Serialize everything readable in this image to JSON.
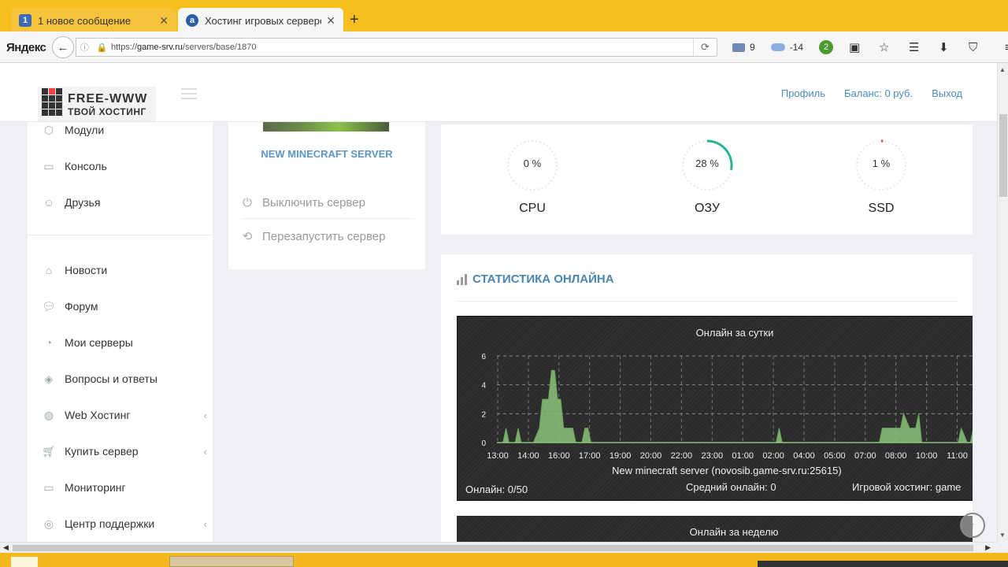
{
  "browser": {
    "tabs": [
      {
        "label": "1 новое сообщение",
        "favicon": "1"
      },
      {
        "label": "Хостинг игровых серверо...",
        "favicon": "a"
      }
    ],
    "new_tab_symbol": "+",
    "brand": "Яндекс",
    "url_prefix": "https://",
    "url_host": "game-srv.ru",
    "url_path": "/servers/base/1870",
    "mail_count": "9",
    "weather": "-14",
    "notif_count": "2"
  },
  "header": {
    "logo_line1": "FREE-WWW",
    "logo_line2": "ТВОЙ ХОСТИНГ",
    "nav": [
      "Профиль",
      "Баланс: 0 руб.",
      "Выход"
    ]
  },
  "sidebar": {
    "items_top": [
      {
        "label": "Модули",
        "icon": "modules-icon"
      },
      {
        "label": "Консоль",
        "icon": "monitor-icon"
      },
      {
        "label": "Друзья",
        "icon": "friends-icon"
      }
    ],
    "items_main": [
      {
        "label": "Новости",
        "icon": "home-icon",
        "arrow": false
      },
      {
        "label": "Форум",
        "icon": "chat-icon",
        "arrow": false
      },
      {
        "label": "Мои серверы",
        "icon": "servers-icon",
        "arrow": false
      },
      {
        "label": "Вопросы и ответы",
        "icon": "layers-icon",
        "arrow": false
      },
      {
        "label": "Web Хостинг",
        "icon": "globe-icon",
        "arrow": true
      },
      {
        "label": "Купить сервер",
        "icon": "cart-icon",
        "arrow": true
      },
      {
        "label": "Мониторинг",
        "icon": "monitor-icon",
        "arrow": false
      },
      {
        "label": "Центр поддержки",
        "icon": "lifebuoy-icon",
        "arrow": true
      }
    ]
  },
  "server": {
    "name": "NEW MINECRAFT SERVER",
    "actions": [
      "Выключить сервер",
      "Перезапустить сервер"
    ]
  },
  "resources": [
    {
      "label": "CPU",
      "value_text": "0 %",
      "value": 0
    },
    {
      "label": "ОЗУ",
      "value_text": "28 %",
      "value": 28
    },
    {
      "label": "SSD",
      "value_text": "1 %",
      "value": 1
    }
  ],
  "stats": {
    "title": "СТАТИСТИКА ОНЛАЙНА",
    "chart_day_footer": {
      "server_line": "New minecraft server (novosib.game-srv.ru:25615)",
      "online": "Онлайн: 0/50",
      "average": "Средний онлайн: 0",
      "hosting": "Игровой хостинг: game"
    },
    "chart_week_title": "Онлайн за неделю"
  },
  "chart_data": {
    "type": "area",
    "title": "Онлайн за сутки",
    "xlabel": "",
    "ylabel": "",
    "x_ticks": [
      "13:00",
      "14:00",
      "16:00",
      "17:00",
      "19:00",
      "20:00",
      "22:00",
      "23:00",
      "01:00",
      "02:00",
      "04:00",
      "05:00",
      "07:00",
      "08:00",
      "10:00",
      "11:00"
    ],
    "y_ticks": [
      0,
      2,
      4,
      6
    ],
    "ylim": [
      0,
      6
    ],
    "grid": true,
    "color": "#8cc37b",
    "x": [
      0,
      0.2,
      0.3,
      0.4,
      0.5,
      0.6,
      0.7,
      0.8,
      1.0,
      1.2,
      1.4,
      1.5,
      1.6,
      1.7,
      1.8,
      1.9,
      2.0,
      2.1,
      2.2,
      2.3,
      2.4,
      2.5,
      2.6,
      2.7,
      2.8,
      2.9,
      3.0,
      3.1,
      3.2,
      3.3,
      3.5,
      3.6,
      3.7,
      3.8,
      4.0,
      9.2,
      9.3,
      9.4,
      12.6,
      12.7,
      13.0,
      13.2,
      13.3,
      13.4,
      13.6,
      13.8,
      13.9,
      14.0,
      15.0,
      15.2,
      15.3,
      15.5,
      15.6,
      15.7
    ],
    "y": [
      0,
      0,
      1,
      0,
      0,
      0,
      1,
      0,
      0,
      0,
      1,
      3,
      3,
      3,
      5,
      5,
      3,
      3,
      1,
      1,
      1,
      1,
      0,
      0,
      0,
      1,
      1,
      0,
      0,
      0,
      0,
      0,
      0,
      0,
      0,
      0,
      1,
      0,
      0,
      1,
      1,
      1,
      1,
      2,
      1,
      1,
      2,
      0,
      0,
      0,
      1,
      0,
      0,
      1
    ]
  }
}
